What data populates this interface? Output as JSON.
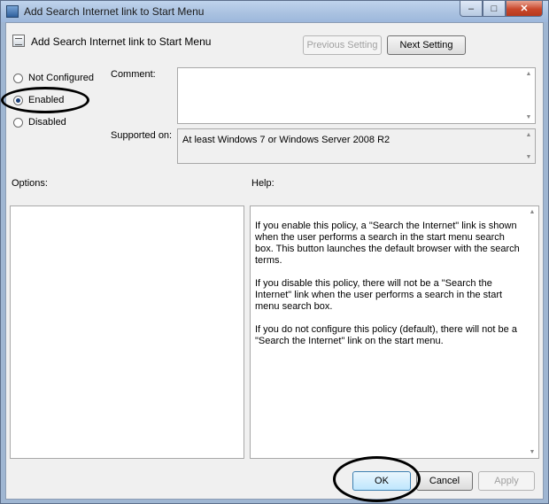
{
  "window": {
    "title": "Add Search Internet link to Start Menu",
    "caption": {
      "minimize": "–",
      "maximize": "□",
      "close": "✕"
    }
  },
  "header": {
    "title": "Add Search Internet link to Start Menu",
    "previous_label": "Previous Setting",
    "next_label": "Next Setting"
  },
  "state": {
    "options": [
      {
        "label": "Not Configured",
        "checked": false
      },
      {
        "label": "Enabled",
        "checked": true
      },
      {
        "label": "Disabled",
        "checked": false
      }
    ]
  },
  "comment": {
    "label": "Comment:",
    "value": ""
  },
  "supported": {
    "label": "Supported on:",
    "value": "At least Windows 7 or Windows Server 2008 R2"
  },
  "options_panel": {
    "label": "Options:"
  },
  "help_panel": {
    "label": "Help:",
    "paragraphs": [
      "If you enable this policy, a \"Search the Internet\" link is shown when the user performs a search in the start menu search box. This button launches the default browser with the search terms.",
      "If you disable this policy, there will not be a \"Search the Internet\" link when the user performs a search in the start menu search box.",
      "If you do not configure this policy (default), there will not be a \"Search the Internet\" link on the start menu."
    ]
  },
  "footer": {
    "ok_label": "OK",
    "cancel_label": "Cancel",
    "apply_label": "Apply"
  },
  "icons": {
    "scroll_up": "▲",
    "scroll_down": "▼"
  }
}
